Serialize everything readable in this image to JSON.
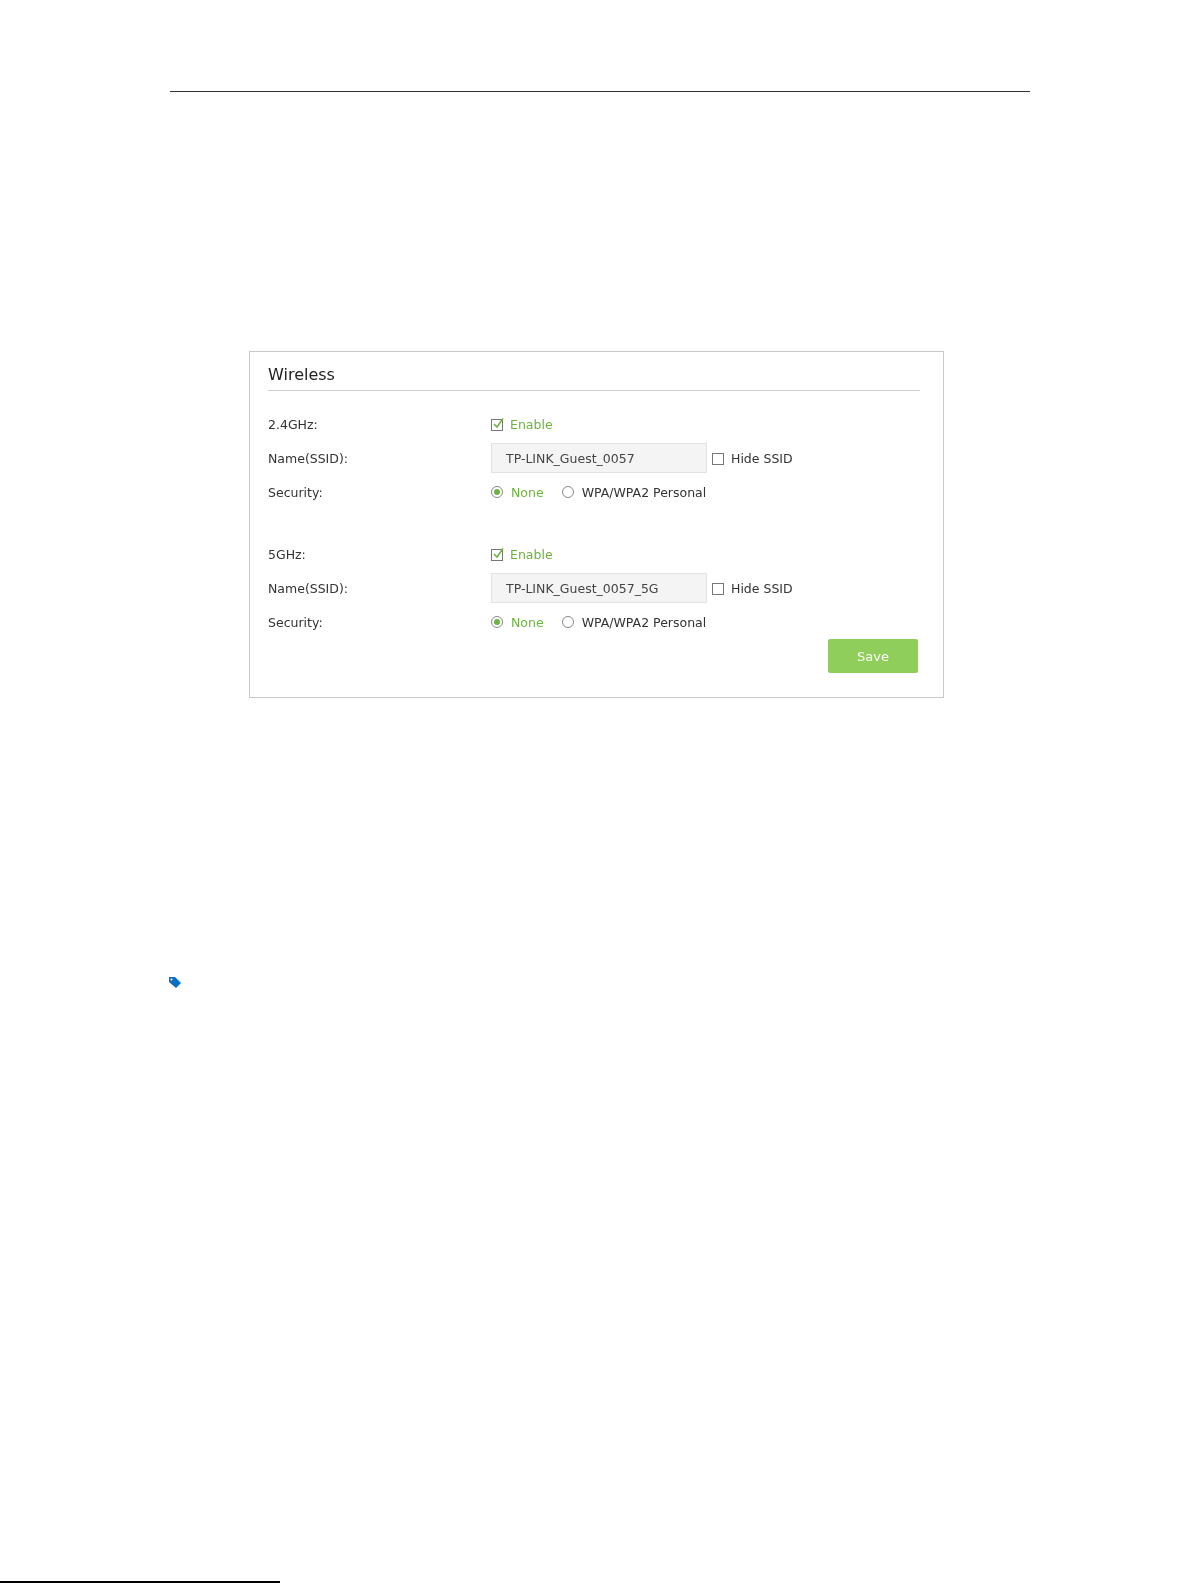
{
  "panel": {
    "title": "Wireless",
    "bands": [
      {
        "band_label": "2.4GHz:",
        "enable": {
          "label": "Enable",
          "checked": true
        },
        "name_label": "Name(SSID):",
        "ssid": "TP-LINK_Guest_0057",
        "hide_ssid": {
          "label": "Hide SSID",
          "checked": false
        },
        "security_label": "Security:",
        "security_options": [
          {
            "label": "None",
            "selected": true
          },
          {
            "label": "WPA/WPA2 Personal",
            "selected": false
          }
        ]
      },
      {
        "band_label": "5GHz:",
        "enable": {
          "label": "Enable",
          "checked": true
        },
        "name_label": "Name(SSID):",
        "ssid": "TP-LINK_Guest_0057_5G",
        "hide_ssid": {
          "label": "Hide SSID",
          "checked": false
        },
        "security_label": "Security:",
        "security_options": [
          {
            "label": "None",
            "selected": true
          },
          {
            "label": "WPA/WPA2 Personal",
            "selected": false
          }
        ]
      }
    ],
    "save_button": "Save"
  }
}
